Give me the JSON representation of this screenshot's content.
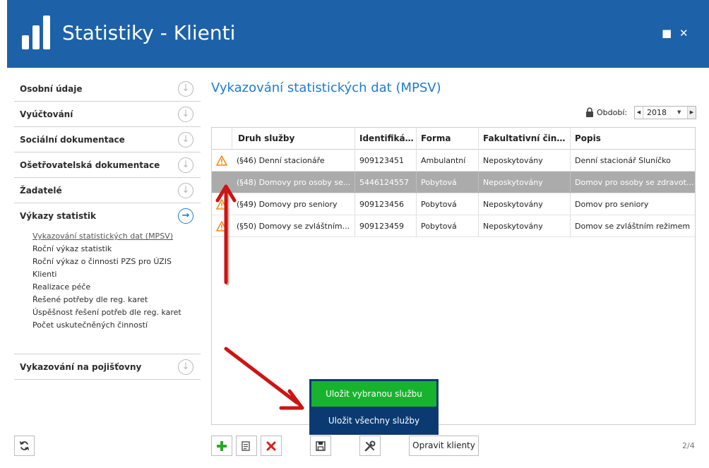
{
  "window": {
    "title": "Statistiky - Klienti",
    "maximize_symbol": "■",
    "close_symbol": "✕"
  },
  "sidebar": {
    "items": [
      {
        "label": "Osobní údaje",
        "icon": "arrow-down-circle-icon"
      },
      {
        "label": "Vyúčtování",
        "icon": "arrow-down-circle-icon"
      },
      {
        "label": "Sociální dokumentace",
        "icon": "arrow-down-circle-icon"
      },
      {
        "label": "Ošetřovatelská dokumentace",
        "icon": "arrow-down-circle-icon"
      },
      {
        "label": "Žadatelé",
        "icon": "arrow-down-circle-icon"
      },
      {
        "label": "Výkazy statistik",
        "icon": "arrow-right-circle-icon"
      }
    ],
    "sub_items": [
      "Vykazování statistických dat (MPSV)",
      "Roční výkaz statistik",
      "Roční výkaz o činnosti PZS pro ÚZIS",
      "Klienti",
      "Realizace péče",
      "Řešené potřeby dle reg. karet",
      "Úspěšnost řešení potřeb dle reg. karet",
      "Počet uskutečněných činností"
    ],
    "last_item": {
      "label": "Vykazování na pojišťovny",
      "icon": "arrow-down-circle-icon"
    }
  },
  "main": {
    "title": "Vykazování statistických dat (MPSV)",
    "period_label": "Období:",
    "period_value": "2018"
  },
  "grid": {
    "columns": [
      "",
      "Druh služby",
      "Identifikátor",
      "Forma",
      "Fakultativní činnosti",
      "Popis"
    ],
    "rows": [
      {
        "warning": true,
        "druh": "(§46) Denní stacionáře",
        "id": "909123451",
        "forma": "Ambulantní",
        "fak": "Neposkytovány",
        "popis": "Denní stacionář Sluníčko"
      },
      {
        "warning": false,
        "druh": "(§48) Domovy pro osoby se...",
        "id": "5446124557",
        "forma": "Pobytová",
        "fak": "Neposkytovány",
        "popis": "Domov pro osoby se zdravotním..."
      },
      {
        "warning": true,
        "druh": "(§49) Domovy pro seniory",
        "id": "909123456",
        "forma": "Pobytová",
        "fak": "Neposkytovány",
        "popis": "Domov pro seniory"
      },
      {
        "warning": true,
        "druh": "(§50) Domovy se zvláštním...",
        "id": "909123459",
        "forma": "Pobytová",
        "fak": "Neposkytovány",
        "popis": "Domov se zvláštním režimem"
      }
    ],
    "selected_row": 1
  },
  "popup": {
    "option_selected": "Uložit vybranou službu",
    "option_all": "Uložit všechny služby"
  },
  "toolbar": {
    "fix_clients": "Opravit klienty",
    "page_indicator": "2/4"
  },
  "colors": {
    "header": "#1d62a8",
    "accent": "#1d7bd1",
    "popup_green": "#17b32f",
    "popup_blue": "#0b3a72",
    "arrow_red": "#cc1414"
  }
}
